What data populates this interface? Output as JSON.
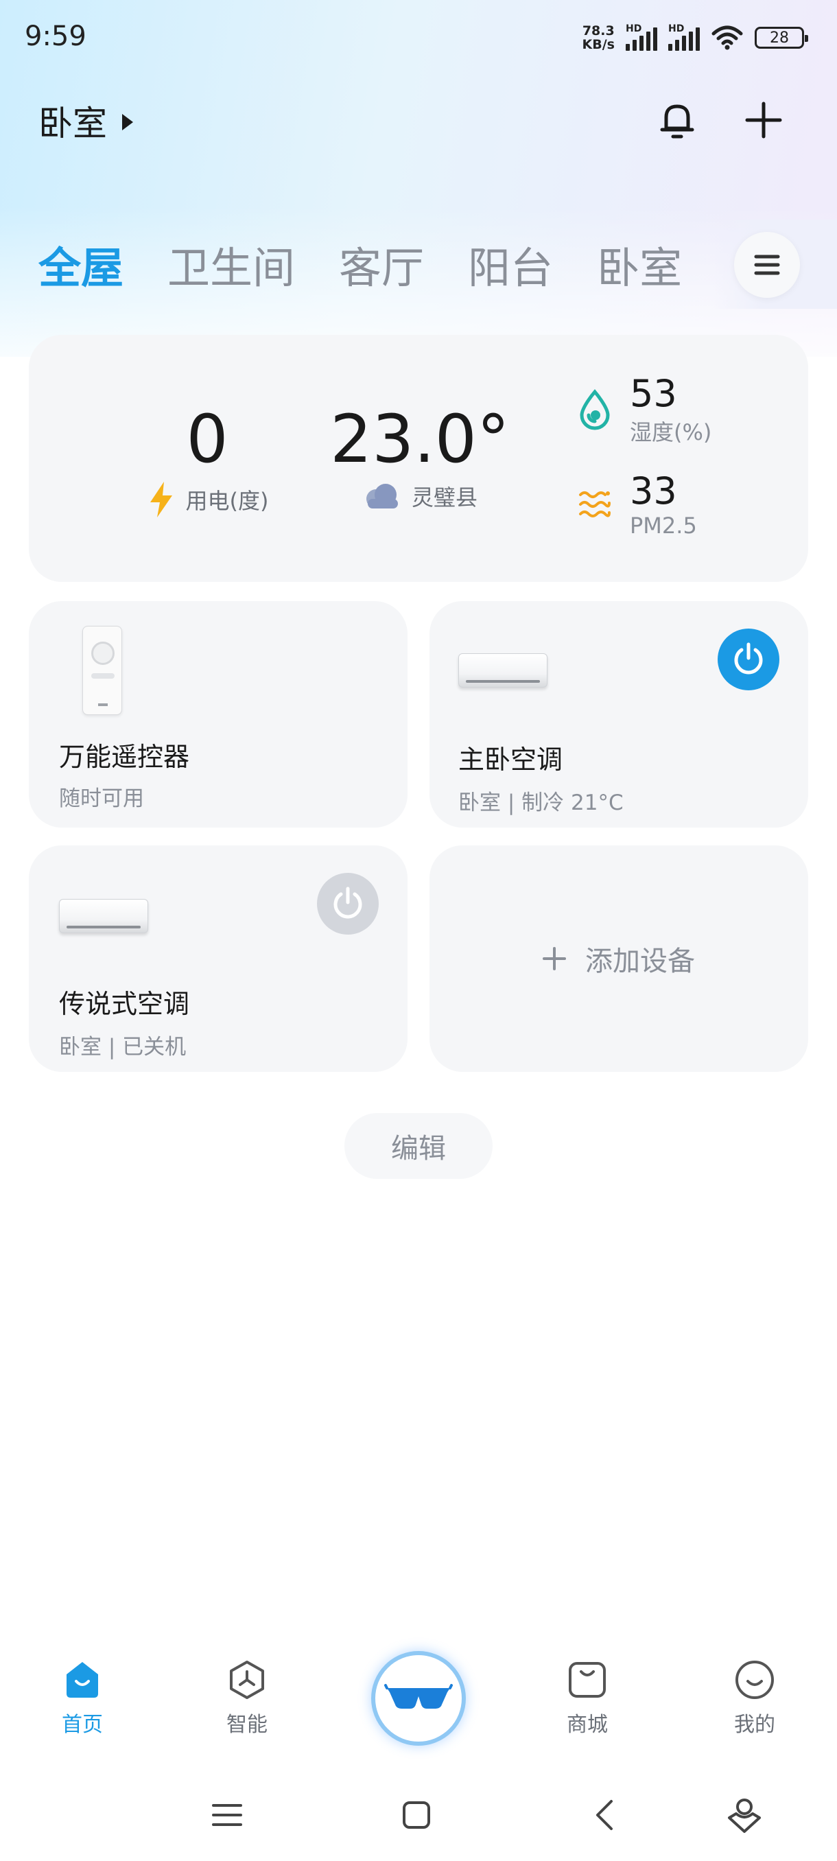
{
  "status_bar": {
    "time": "9:59",
    "net_speed_value": "78.3",
    "net_speed_unit": "KB/s",
    "hd_label_1": "HD",
    "hd_label_2": "HD",
    "battery": "28"
  },
  "header": {
    "room": "卧室",
    "notification_icon": "bell-icon",
    "add_icon": "plus-icon"
  },
  "tabs": [
    {
      "label": "全屋",
      "active": true
    },
    {
      "label": "卫生间",
      "active": false
    },
    {
      "label": "客厅",
      "active": false
    },
    {
      "label": "阳台",
      "active": false
    },
    {
      "label": "卧室",
      "active": false
    }
  ],
  "stats": {
    "power_value": "0",
    "power_label": "用电(度)",
    "temp_value": "23.0°",
    "location": "灵璧县",
    "humidity_value": "53",
    "humidity_label": "湿度(%)",
    "pm_value": "33",
    "pm_label": "PM2.5"
  },
  "devices": [
    {
      "name": "万能遥控器",
      "sub": "随时可用"
    },
    {
      "name": "主卧空调",
      "sub": "卧室 | 制冷 21°C",
      "power_on": true
    },
    {
      "name": "传说式空调",
      "sub": "卧室 | 已关机",
      "power_on": false
    }
  ],
  "add_device": "添加设备",
  "edit": "编辑",
  "bottom_nav": [
    {
      "label": "首页",
      "icon": "home-icon",
      "active": true
    },
    {
      "label": "智能",
      "icon": "smart-hex-icon",
      "active": false
    },
    {
      "label": "商城",
      "icon": "shop-bag-icon",
      "active": false
    },
    {
      "label": "我的",
      "icon": "profile-smile-icon",
      "active": false
    }
  ],
  "colors": {
    "accent": "#1b9ae4",
    "power_on": "#1b9ae4",
    "power_off": "#d3d6dc",
    "card_bg": "#f5f6f8"
  }
}
